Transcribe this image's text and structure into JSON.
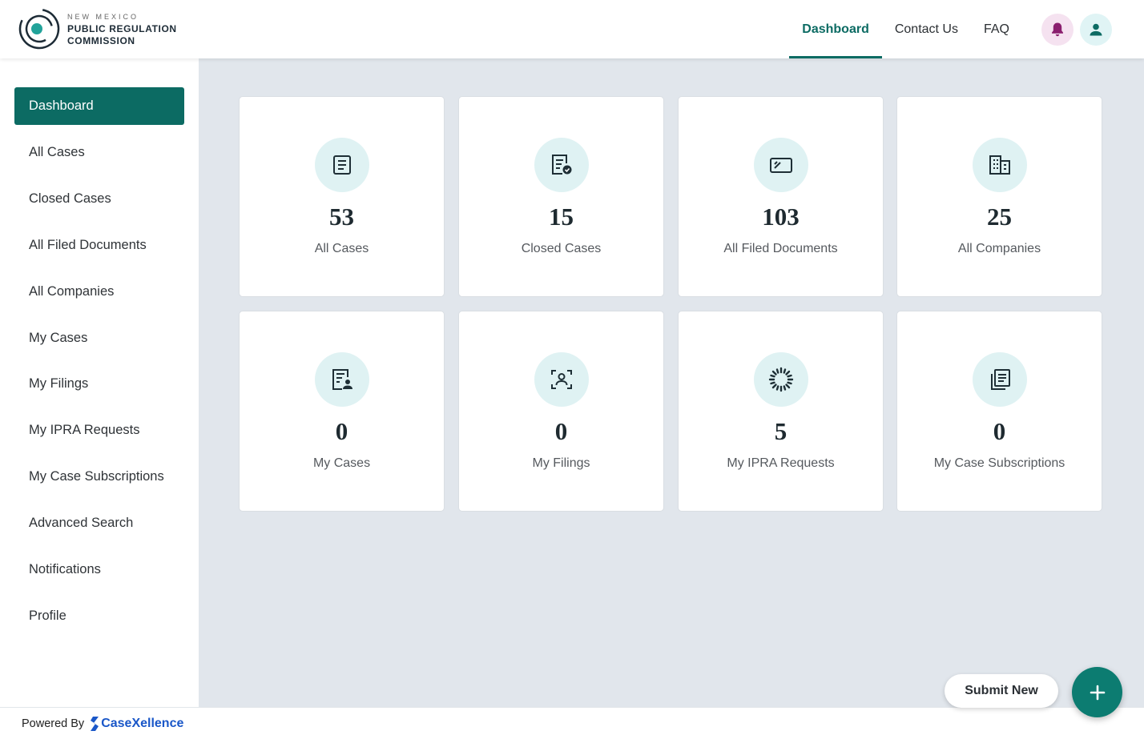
{
  "app": {
    "logo_state": "NEW MEXICO",
    "logo_line1": "PUBLIC REGULATION",
    "logo_line2": "COMMISSION"
  },
  "topnav": {
    "items": [
      {
        "label": "Dashboard",
        "active": true
      },
      {
        "label": "Contact Us",
        "active": false
      },
      {
        "label": "FAQ",
        "active": false
      }
    ],
    "notification_icon": "bell-icon",
    "profile_icon": "user-icon"
  },
  "sidebar": {
    "items": [
      {
        "label": "Dashboard",
        "active": true
      },
      {
        "label": "All Cases"
      },
      {
        "label": "Closed Cases"
      },
      {
        "label": "All Filed Documents"
      },
      {
        "label": "All Companies"
      },
      {
        "label": "My Cases"
      },
      {
        "label": "My Filings"
      },
      {
        "label": "My IPRA Requests"
      },
      {
        "label": "My Case Subscriptions"
      },
      {
        "label": "Advanced Search"
      },
      {
        "label": "Notifications"
      },
      {
        "label": "Profile"
      }
    ]
  },
  "cards": [
    {
      "value": "53",
      "label": "All Cases",
      "icon": "document-list-icon"
    },
    {
      "value": "15",
      "label": "Closed Cases",
      "icon": "document-check-icon"
    },
    {
      "value": "103",
      "label": "All Filed Documents",
      "icon": "folder-icon"
    },
    {
      "value": "25",
      "label": "All Companies",
      "icon": "building-icon"
    },
    {
      "value": "0",
      "label": "My Cases",
      "icon": "document-person-icon"
    },
    {
      "value": "0",
      "label": "My Filings",
      "icon": "person-frame-icon"
    },
    {
      "value": "5",
      "label": "My IPRA Requests",
      "icon": "spinner-icon"
    },
    {
      "value": "0",
      "label": "My Case Subscriptions",
      "icon": "stacked-documents-icon"
    }
  ],
  "footer": {
    "powered_by": "Powered By",
    "brand": "CaseXellence"
  },
  "actions": {
    "submit_new": "Submit New"
  },
  "colors": {
    "primary": "#0c6b63",
    "fab": "#0c7c71",
    "icon_bg": "#dff2f3",
    "bell_bg": "#f5e2f0",
    "bell": "#8a1f6e",
    "brand": "#1a57c8",
    "background": "#e1e6ec"
  }
}
